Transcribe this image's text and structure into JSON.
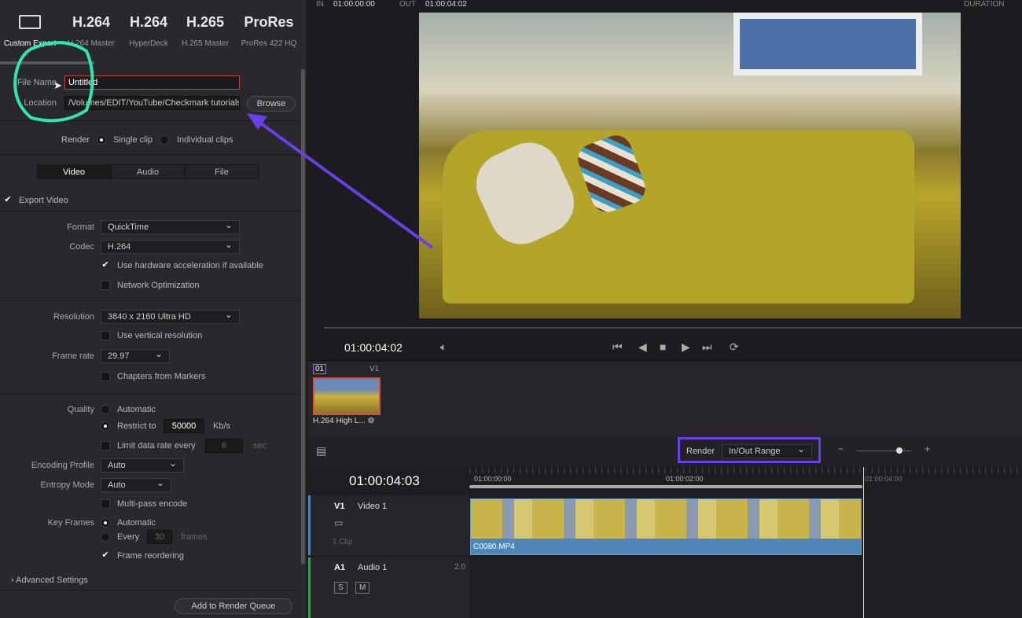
{
  "presets": [
    {
      "big": "",
      "label": "Custom Export",
      "icon": "film-icon"
    },
    {
      "big": "H.264",
      "label": "H.264 Master"
    },
    {
      "big": "H.264",
      "label": "HyperDeck"
    },
    {
      "big": "H.265",
      "label": "H.265 Master"
    },
    {
      "big": "ProRes",
      "label": "ProRes 422 HQ"
    }
  ],
  "file": {
    "name_label": "File Name",
    "name_value": "Untitled",
    "location_label": "Location",
    "location_value": "/Volumes/EDIT/YouTube/Checkmark tutorials",
    "browse": "Browse"
  },
  "render": {
    "label": "Render",
    "single": "Single clip",
    "individual": "Individual clips"
  },
  "tabs": [
    "Video",
    "Audio",
    "File"
  ],
  "video": {
    "export_video": "Export Video",
    "format_label": "Format",
    "format": "QuickTime",
    "codec_label": "Codec",
    "codec": "H.264",
    "hw_accel": "Use hardware acceleration if available",
    "network_opt": "Network Optimization",
    "resolution_label": "Resolution",
    "resolution": "3840 x 2160 Ultra HD",
    "vertical": "Use vertical resolution",
    "framerate_label": "Frame rate",
    "framerate": "29.97",
    "chapters": "Chapters from Markers",
    "quality_label": "Quality",
    "automatic": "Automatic",
    "restrict": "Restrict to",
    "kbs_value": "50000",
    "kbs": "Kb/s",
    "limit": "Limit data rate every",
    "limit_value": "6",
    "sec": "sec",
    "encoding_label": "Encoding Profile",
    "encoding": "Auto",
    "entropy_label": "Entropy Mode",
    "entropy": "Auto",
    "multipass": "Multi-pass encode",
    "keyframes_label": "Key Frames",
    "kf_auto": "Automatic",
    "kf_every": "Every",
    "kf_value": "30",
    "frames": "frames",
    "reorder": "Frame reordering",
    "advanced": "Advanced Settings",
    "add_queue": "Add to Render Queue"
  },
  "viewer": {
    "in_label": "IN",
    "in": "01:00:00:00",
    "out_label": "OUT",
    "out": "01:00:04:02",
    "duration_label": "DURATION",
    "timecode": "01:00:04:02"
  },
  "clips": {
    "index": "01",
    "track": "V1",
    "name": "H.264 High L..."
  },
  "timeline": {
    "render_label": "Render",
    "render_value": "In/Out Range",
    "timecode": "01:00:04:03",
    "ruler": [
      "01:00:00:00",
      "01:00:02:00",
      "01:00:04:00"
    ],
    "v1": "V1",
    "v1_name": "Video 1",
    "v1_count": "1 Clip",
    "clip_name": "C0080.MP4",
    "a1": "A1",
    "a1_name": "Audio 1",
    "a1_ch": "2.0",
    "solo": "S",
    "mute": "M"
  },
  "colors": {
    "annotation_circle": "#2ee6b0",
    "annotation_arrow": "#6a3fe6",
    "highlight_box": "#6a3fe6",
    "clip_blue": "#4f86b8"
  }
}
